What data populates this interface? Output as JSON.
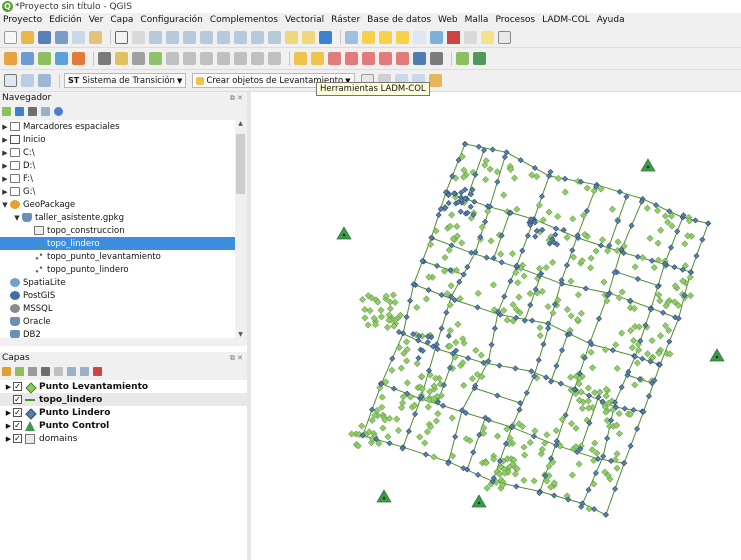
{
  "window": {
    "title": "*Proyecto sin título - QGIS"
  },
  "menubar": [
    "Proyecto",
    "Edición",
    "Ver",
    "Capa",
    "Configuración",
    "Complementos",
    "Vectorial",
    "Ráster",
    "Base de datos",
    "Web",
    "Malla",
    "Procesos",
    "LADM-COL",
    "Ayuda"
  ],
  "toolbar3": {
    "transition_prefix": "ST",
    "transition_label": "Sistema de Transición",
    "survey_label": "Crear objetos de Levantamiento"
  },
  "tooltip": {
    "text": "Herramientas LADM-COL"
  },
  "navigator": {
    "title": "Navegador",
    "tree": [
      {
        "label": "Marcadores espaciales",
        "icon": "bookmark-icon"
      },
      {
        "label": "Inicio",
        "icon": "home-icon"
      },
      {
        "label": "C:\\",
        "icon": "folder-icon"
      },
      {
        "label": "D:\\",
        "icon": "folder-icon"
      },
      {
        "label": "F:\\",
        "icon": "folder-icon"
      },
      {
        "label": "G:\\",
        "icon": "folder-icon"
      },
      {
        "label": "GeoPackage",
        "icon": "geopackage-icon"
      },
      {
        "label": "taller_asistente.gpkg",
        "icon": "database-icon"
      },
      {
        "label": "topo_construccion",
        "icon": "polygon-layer-icon"
      },
      {
        "label": "topo_lindero",
        "icon": "line-layer-icon"
      },
      {
        "label": "topo_punto_levantamiento",
        "icon": "point-layer-icon"
      },
      {
        "label": "topo_punto_lindero",
        "icon": "point-layer-icon"
      },
      {
        "label": "SpatiaLite",
        "icon": "spatialite-icon"
      },
      {
        "label": "PostGIS",
        "icon": "postgis-icon"
      },
      {
        "label": "MSSQL",
        "icon": "mssql-icon"
      },
      {
        "label": "Oracle",
        "icon": "oracle-icon"
      },
      {
        "label": "DB2",
        "icon": "db2-icon"
      }
    ]
  },
  "layers": {
    "title": "Capas",
    "items": [
      {
        "label": "Punto Levantamiento",
        "symbol": "green-diamond",
        "checked": "✓"
      },
      {
        "label": "topo_lindero",
        "symbol": "green-line",
        "checked": "✓"
      },
      {
        "label": "Punto Lindero",
        "symbol": "blue-diamond",
        "checked": "✓"
      },
      {
        "label": "Punto Control",
        "symbol": "green-triangle",
        "checked": "✓"
      },
      {
        "label": "domains",
        "symbol": "group",
        "checked": "✓"
      }
    ]
  },
  "map": {
    "colors": {
      "lindero": "#4f8e2c",
      "survey_point": "#8fce67",
      "survey_point_stroke": "#4d7f2e",
      "boundary_point": "#5b7fa8",
      "boundary_point_stroke": "#2d4d74",
      "control_point": "#3c9a48",
      "background": "#ffffff"
    }
  }
}
